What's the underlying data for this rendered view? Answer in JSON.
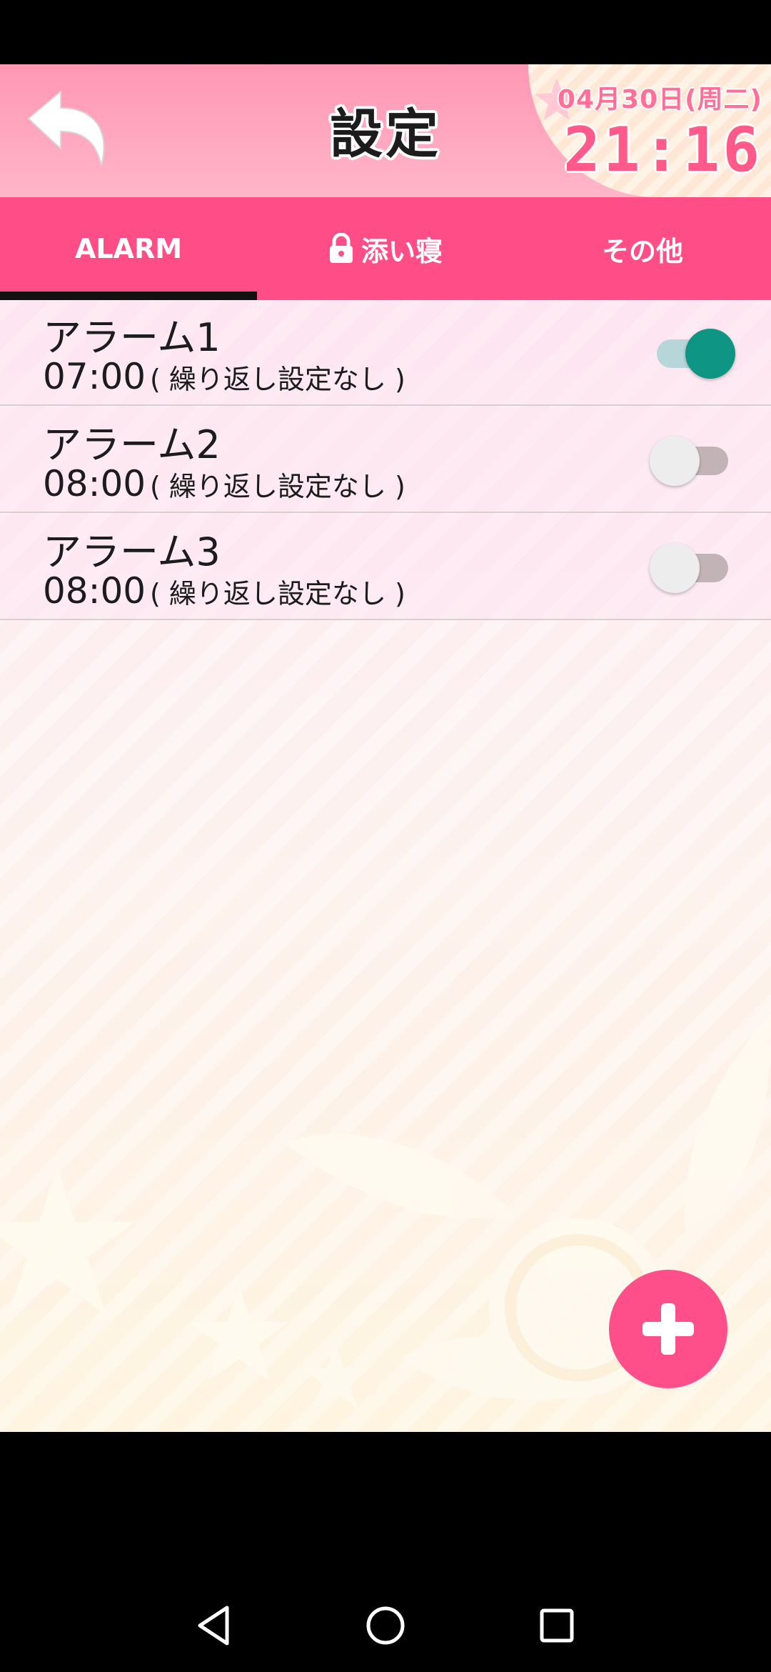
{
  "header": {
    "title": "設定",
    "date": "04月30日(周二)",
    "time": "21:16",
    "back_icon": "back-arrow-icon"
  },
  "tabs": [
    {
      "label": "ALARM",
      "active": true
    },
    {
      "label": "添い寝",
      "active": false,
      "icon": "lock-icon"
    },
    {
      "label": "その他",
      "active": false
    }
  ],
  "alarms": [
    {
      "name": "アラーム1",
      "time": "07:00",
      "repeat": "( 繰り返し設定なし )",
      "enabled": true
    },
    {
      "name": "アラーム2",
      "time": "08:00",
      "repeat": "( 繰り返し設定なし )",
      "enabled": false
    },
    {
      "name": "アラーム3",
      "time": "08:00",
      "repeat": "( 繰り返し設定なし )",
      "enabled": false
    }
  ],
  "fab": {
    "icon": "plus-icon"
  },
  "nav": {
    "back_icon": "nav-back-icon",
    "home_icon": "nav-home-icon",
    "recents_icon": "nav-recents-icon"
  },
  "colors": {
    "accent": "#ff4d87",
    "toggle_on": "#0f9584",
    "header": "#ff97b3"
  }
}
